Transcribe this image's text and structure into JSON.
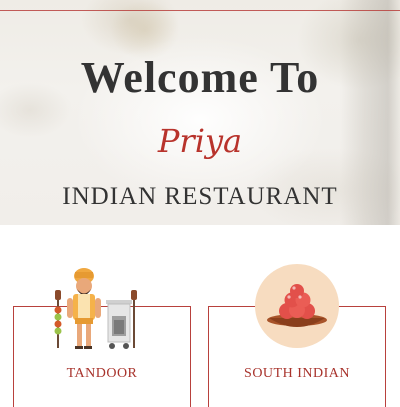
{
  "hero": {
    "welcome": "Welcome To",
    "brand": "Priya",
    "subtitle": "INDIAN RESTAURANT"
  },
  "categories": [
    {
      "label": "TANDOOR",
      "icon": "tandoor-chef-icon"
    },
    {
      "label": "SOUTH INDIAN",
      "icon": "sweets-bowl-icon"
    }
  ],
  "colors": {
    "accent": "#b8413d",
    "brand": "#b8332c",
    "text": "#333333"
  }
}
